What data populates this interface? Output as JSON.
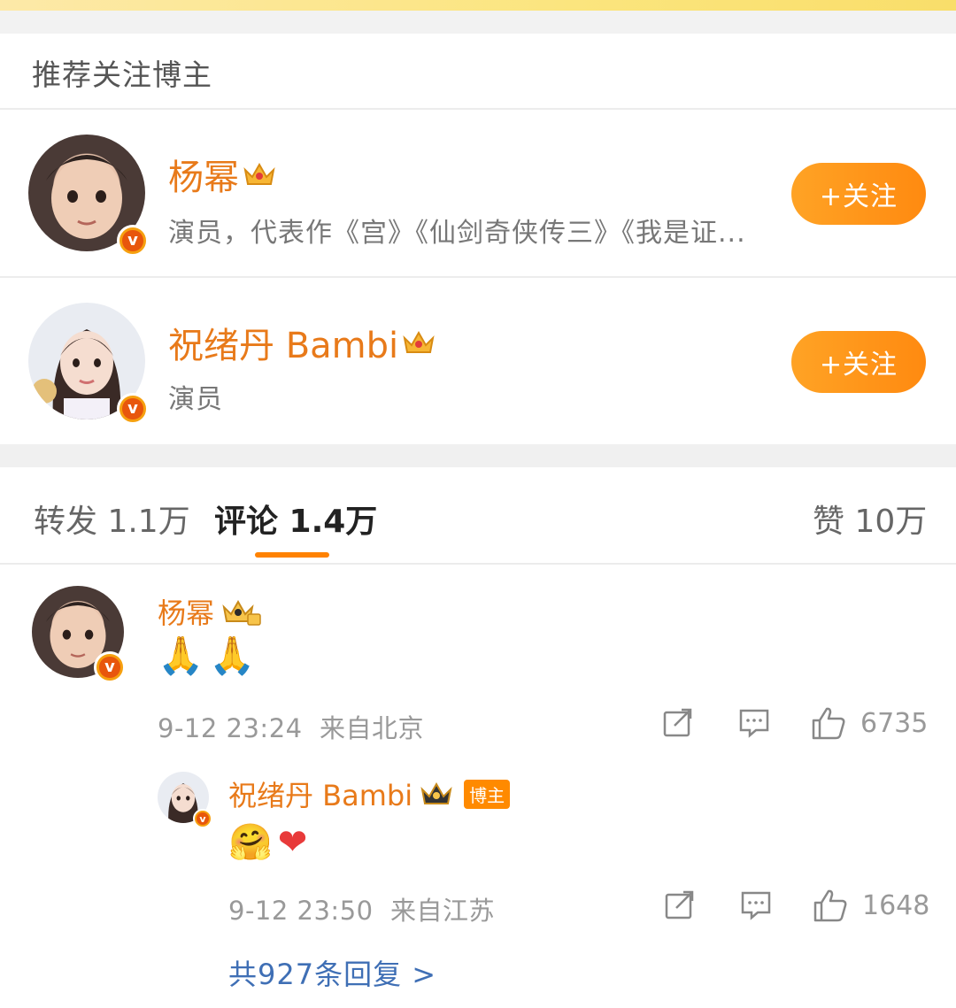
{
  "recommend": {
    "title": "推荐关注博主",
    "users": [
      {
        "name": "杨幂",
        "desc": "演员，代表作《宫》《仙剑奇侠传三》《我是证...",
        "follow_label": "+关注"
      },
      {
        "name": "祝绪丹 Bambi",
        "desc": "演员",
        "follow_label": "+关注"
      }
    ]
  },
  "tabs": {
    "repost": "转发 1.1万",
    "comments": "评论 1.4万",
    "likes": "赞 10万"
  },
  "comments": [
    {
      "name": "杨幂",
      "body_emoji": "🙏🙏",
      "time": "9-12 23:24",
      "location": "来自北京",
      "likes": "6735"
    }
  ],
  "reply": {
    "name": "祝绪丹 Bambi",
    "author_tag": "博主",
    "body_emoji": "🤗❤",
    "time": "9-12 23:50",
    "location": "来自江苏",
    "likes": "1648"
  },
  "more_replies": "共927条回复 >",
  "colors": {
    "accent": "#ff8200",
    "name": "#e87a1a",
    "link": "#3f6fb5"
  }
}
